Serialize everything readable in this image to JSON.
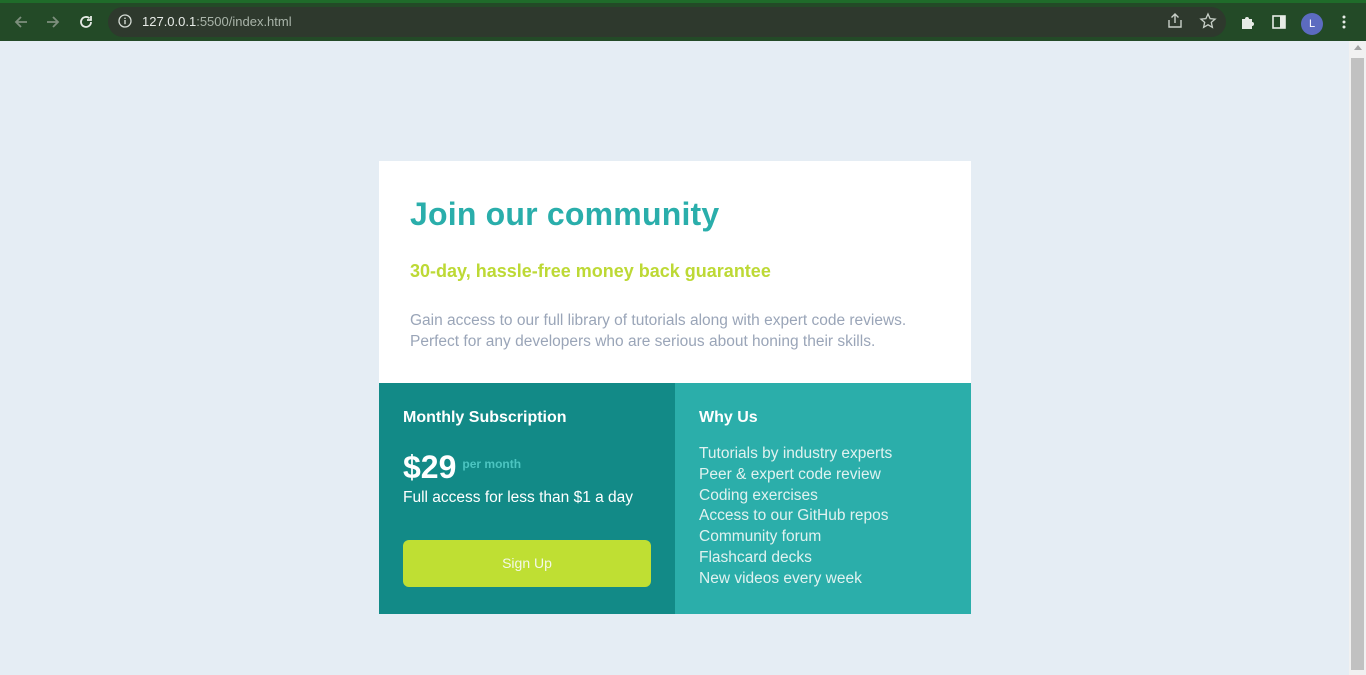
{
  "browser": {
    "url_host": "127.0.0.1",
    "url_rest": ":5500/index.html",
    "profile_initial": "L"
  },
  "hero": {
    "title": "Join our community",
    "subtitle": "30-day, hassle-free money back guarantee",
    "description": "Gain access to our full library of tutorials along with expert code reviews. Perfect for any developers who are serious about honing their skills."
  },
  "subscription": {
    "heading": "Monthly Subscription",
    "price": "$29",
    "period": "per month",
    "note": "Full access for less than $1 a day",
    "button_label": "Sign Up"
  },
  "why": {
    "heading": "Why Us",
    "items": [
      "Tutorials by industry experts",
      "Peer & expert code review",
      "Coding exercises",
      "Access to our GitHub repos",
      "Community forum",
      "Flashcard decks",
      "New videos every week"
    ]
  },
  "colors": {
    "page_bg": "#e5edf4",
    "accent_teal": "#2aaeab",
    "accent_lime": "#bdd935",
    "left_panel": "#128a87",
    "right_panel": "#2baeaa",
    "button": "#bfdf33",
    "chrome": "#234a27"
  }
}
